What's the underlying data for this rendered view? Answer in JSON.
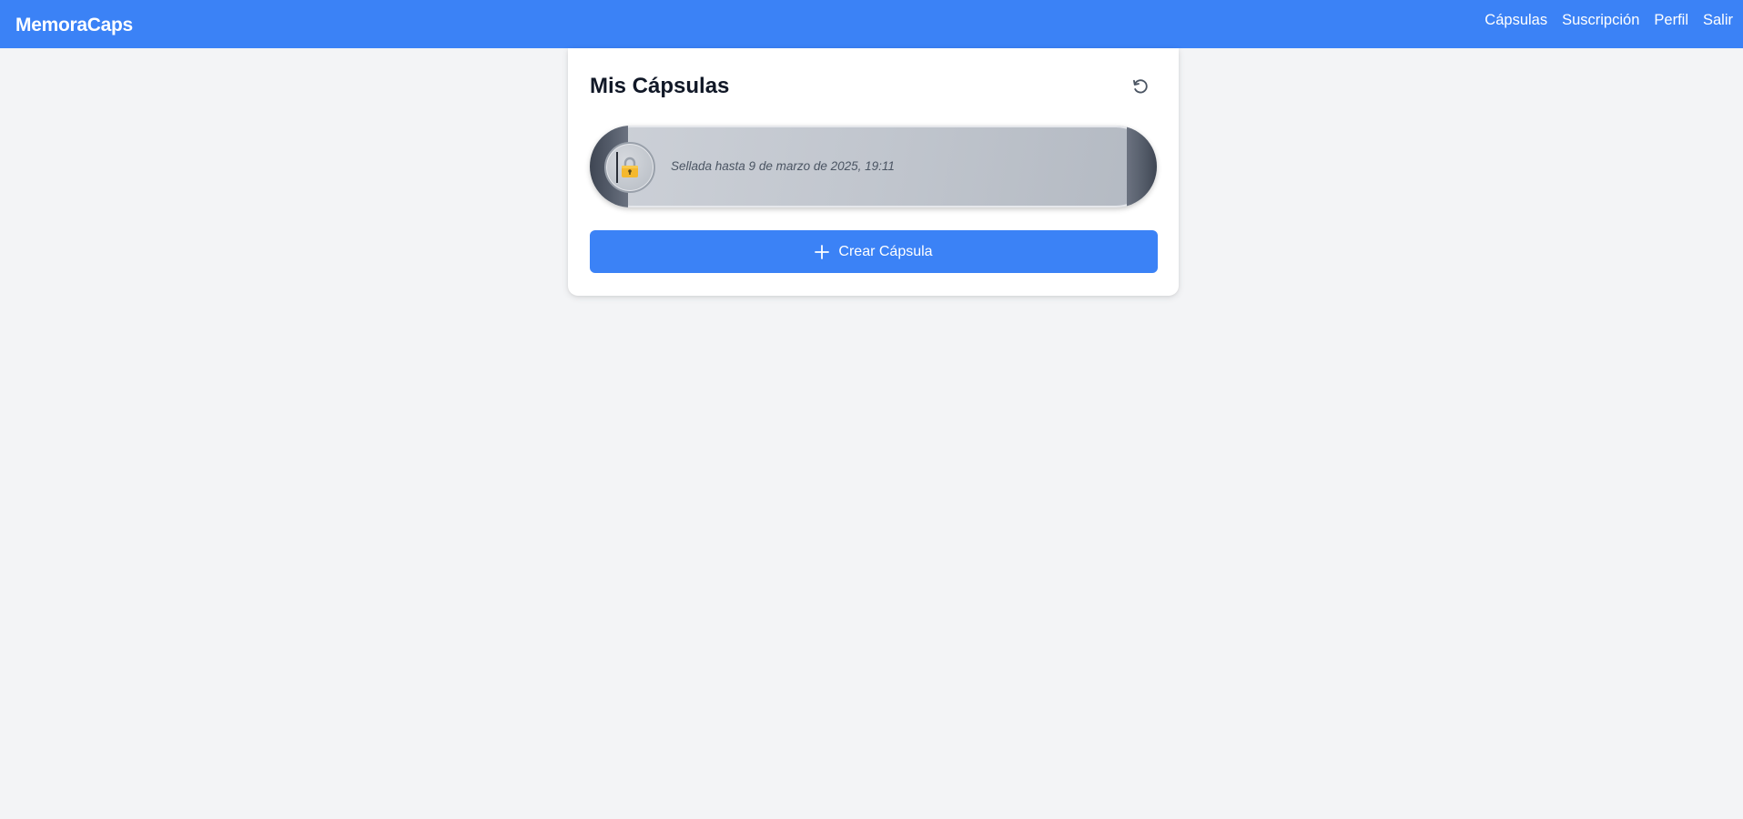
{
  "nav": {
    "brand": "MemoraCaps",
    "links": [
      {
        "label": "Cápsulas"
      },
      {
        "label": "Suscripción"
      },
      {
        "label": "Perfil"
      },
      {
        "label": "Salir"
      }
    ]
  },
  "main": {
    "title": "Mis Cápsulas",
    "refresh_icon": "refresh-icon",
    "capsules": [
      {
        "status_icon": "lock-icon",
        "status_text": "Sellada hasta 9 de marzo de 2025, 19:11"
      }
    ],
    "create_button": {
      "icon": "plus-icon",
      "label": "Crear Cápsula"
    }
  },
  "colors": {
    "primary": "#3b82f6",
    "background": "#f3f4f6",
    "card": "#ffffff",
    "title": "#111827",
    "capsule_body": "#c1c6ce",
    "capsule_cap": "#4b5563",
    "lock": "#f5b82e"
  }
}
